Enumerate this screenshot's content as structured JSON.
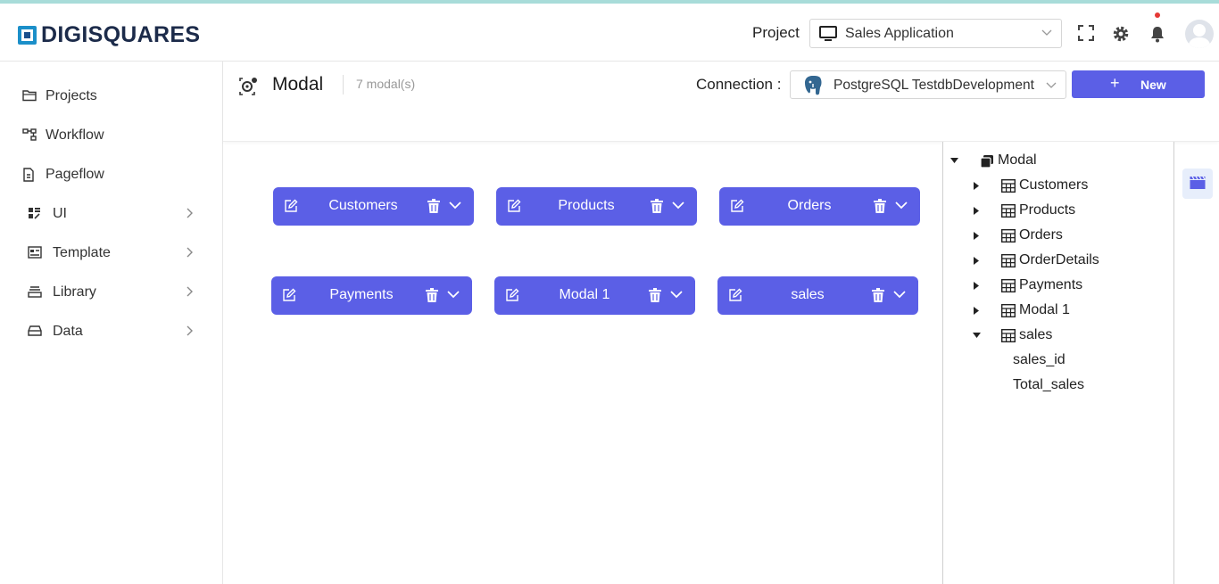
{
  "header": {
    "logo_text": "DIGISQUARES",
    "project_label": "Project",
    "project_value": "Sales Application"
  },
  "sidebar": {
    "items": [
      {
        "label": "Projects",
        "icon": "folder-icon"
      },
      {
        "label": "Workflow",
        "icon": "workflow-icon"
      },
      {
        "label": "Pageflow",
        "icon": "pageflow-icon"
      },
      {
        "label": "UI",
        "icon": "ui-icon"
      },
      {
        "label": "Template",
        "icon": "template-icon"
      },
      {
        "label": "Library",
        "icon": "library-icon"
      },
      {
        "label": "Data",
        "icon": "data-icon"
      }
    ]
  },
  "page": {
    "title": "Modal",
    "count": "7 modal(s)",
    "connection_label": "Connection :",
    "connection_value": "PostgreSQL TestdbDevelopment",
    "new_button": "New"
  },
  "modals": [
    {
      "name": "Customers"
    },
    {
      "name": "Products"
    },
    {
      "name": "Orders"
    },
    {
      "name": "Payments"
    },
    {
      "name": "Modal 1"
    },
    {
      "name": "sales"
    }
  ],
  "tree": {
    "root": "Modal",
    "items": [
      {
        "label": "Customers",
        "expanded": false
      },
      {
        "label": "Products",
        "expanded": false
      },
      {
        "label": "Orders",
        "expanded": false
      },
      {
        "label": "OrderDetails",
        "expanded": false
      },
      {
        "label": "Payments",
        "expanded": false
      },
      {
        "label": "Modal 1",
        "expanded": false
      },
      {
        "label": "sales",
        "expanded": true,
        "children": [
          "sales_id",
          "Total_sales"
        ]
      }
    ]
  },
  "colors": {
    "accent": "#5b5fe6",
    "brand": "#1b8fc9",
    "notification": "#e53935"
  }
}
